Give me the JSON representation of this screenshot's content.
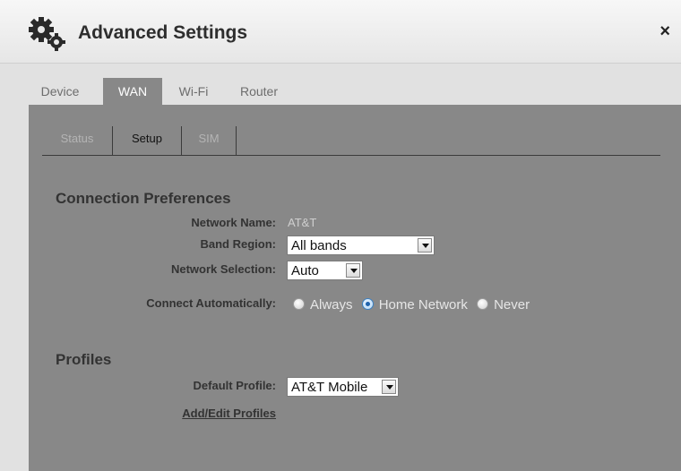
{
  "header": {
    "title": "Advanced Settings",
    "close_symbol": "×",
    "icon": "gears-icon"
  },
  "main_tabs": [
    {
      "label": "Device",
      "active": false
    },
    {
      "label": "WAN",
      "active": true
    },
    {
      "label": "Wi-Fi",
      "active": false
    },
    {
      "label": "Router",
      "active": false
    }
  ],
  "sub_tabs": [
    {
      "label": "Status",
      "state": "disabled"
    },
    {
      "label": "Setup",
      "state": "active"
    },
    {
      "label": "SIM",
      "state": "disabled"
    }
  ],
  "connection": {
    "section_title": "Connection Preferences",
    "network_name_label": "Network Name:",
    "network_name_value": "AT&T",
    "band_region_label": "Band Region:",
    "band_region_value": "All bands",
    "network_selection_label": "Network Selection:",
    "network_selection_value": "Auto",
    "connect_auto_label": "Connect Automatically:",
    "connect_options": [
      {
        "label": "Always",
        "checked": false
      },
      {
        "label": "Home Network",
        "checked": true
      },
      {
        "label": "Never",
        "checked": false
      }
    ]
  },
  "profiles": {
    "section_title": "Profiles",
    "default_profile_label": "Default Profile:",
    "default_profile_value": "AT&T Mobile",
    "add_edit_link": "Add/Edit Profiles"
  },
  "colors": {
    "panel_bg": "#888888",
    "radio_selected": "#1f63ad"
  }
}
